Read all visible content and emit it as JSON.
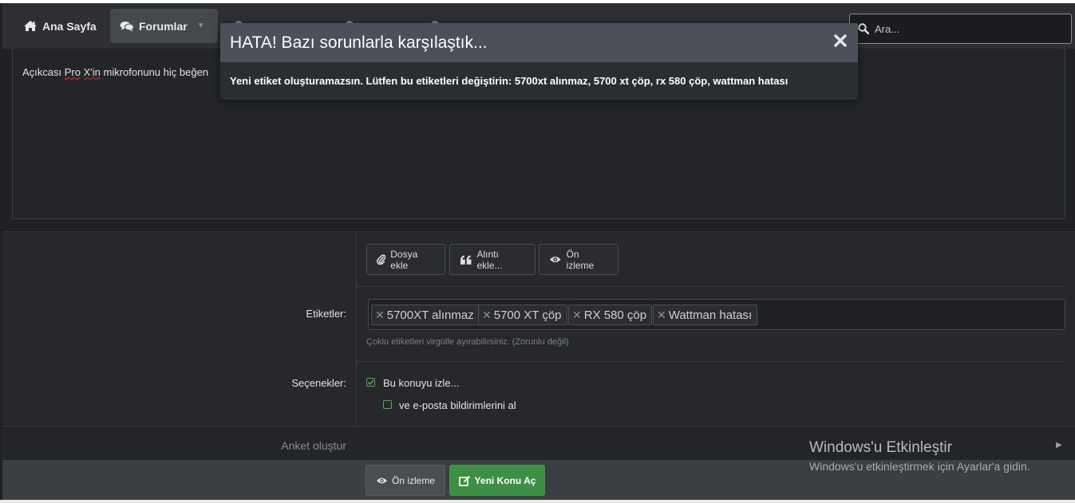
{
  "nav": {
    "home_label": "Ana Sayfa",
    "forums_label": "Forumlar",
    "search_placeholder": "Ara..."
  },
  "editor": {
    "text_prefix": "Açıkcası ",
    "text_pro": "Pro",
    "text_space": " ",
    "text_x": "X'in",
    "text_rest": " mikrofonunu hiç beğen"
  },
  "toolbar": {
    "attach_label": "Dosya ekle",
    "quote_label": "Alıntı ekle...",
    "preview_label": "Ön izleme"
  },
  "tags": {
    "label": "Etiketler:",
    "items": [
      "5700XT alınmaz",
      "5700 XT çöp",
      "RX 580 çöp",
      "Wattman hatası"
    ],
    "hint": "Çoklu etiketleri virgülle ayırabilirsiniz. (Zorunlu değil)"
  },
  "options": {
    "label": "Seçenekler:",
    "watch_label": "Bu konuyu izle...",
    "watch_checked": true,
    "email_label": "ve e-posta bildirimlerini al",
    "email_checked": false
  },
  "poll": {
    "label": "Anket oluştur"
  },
  "footer": {
    "preview_label": "Ön izleme",
    "submit_label": "Yeni Konu Aç"
  },
  "modal": {
    "title": "HATA! Bazı sorunlarla karşılaştık...",
    "message": "Yeni etiket oluşturamazsın. Lütfen bu etiketleri değiştirin: 5700xt alınmaz, 5700 xt çöp, rx 580 çöp, wattman hatası"
  },
  "watermark": {
    "title": "Windows'u Etkinleştir",
    "subtitle": "Windows'u etkinleştirmek için Ayarlar'a gidin."
  },
  "colors": {
    "accent_green": "#3e8e45",
    "modal_header": "#4c5059",
    "background": "#1f2124"
  }
}
